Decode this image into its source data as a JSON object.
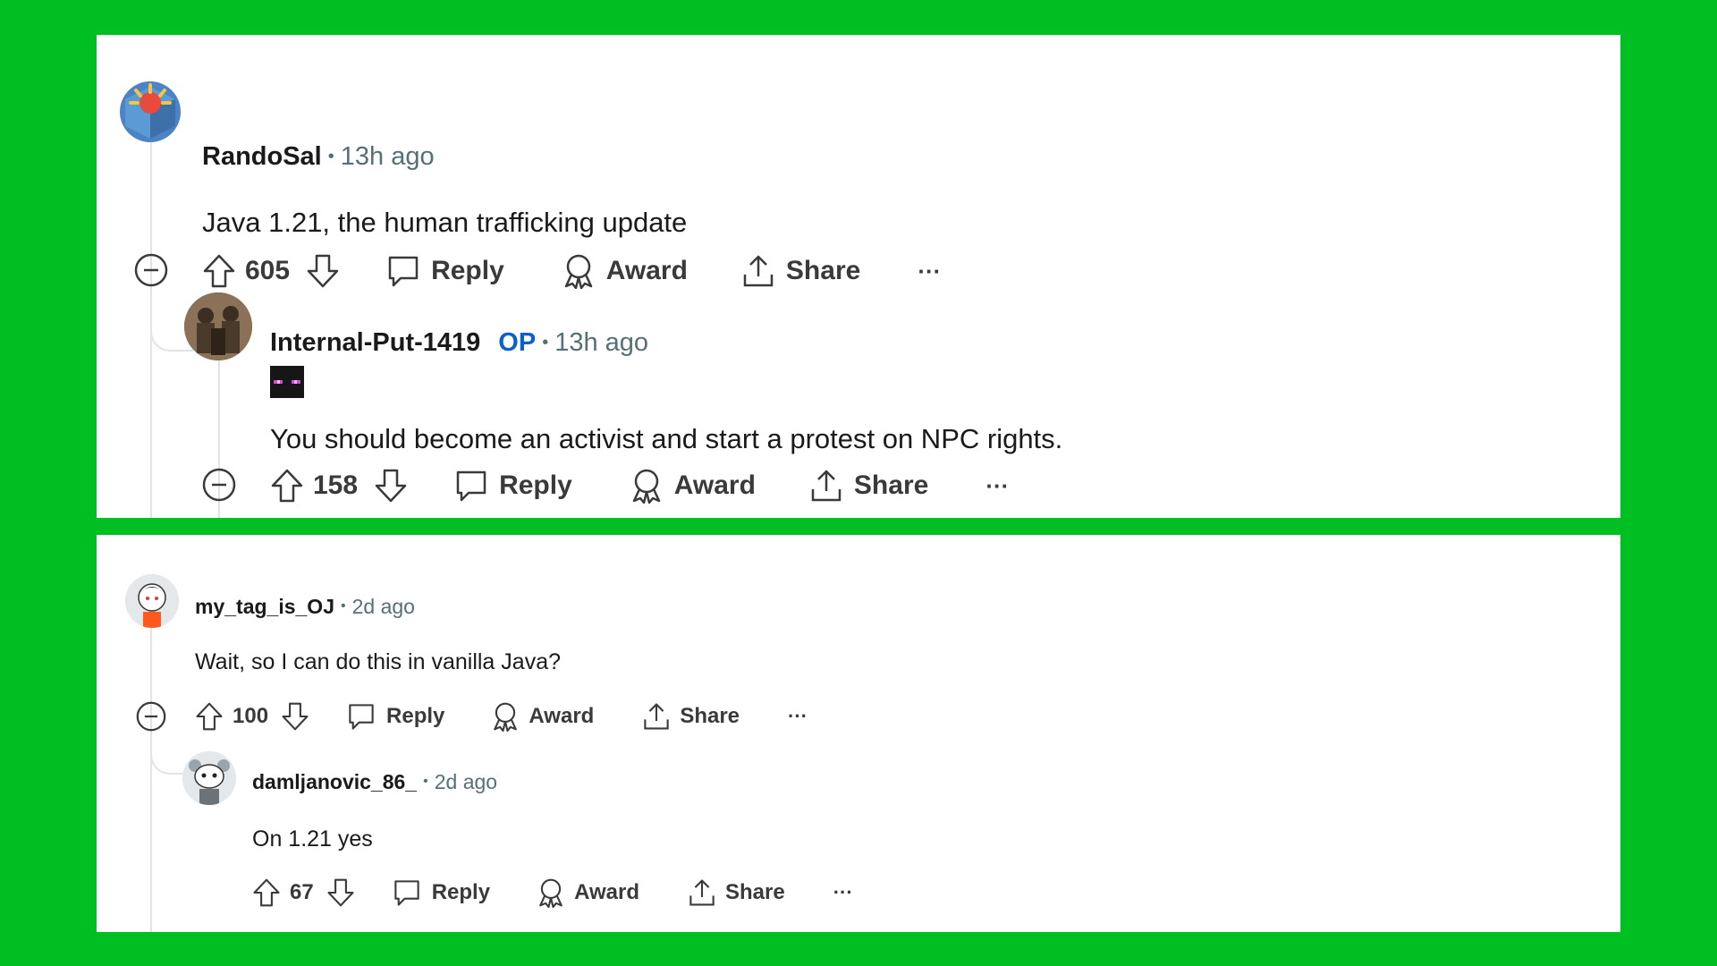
{
  "colors": {
    "background": "#00bf22",
    "panel": "#ffffff",
    "op_badge": "#0a5fd1",
    "meta": "#576f76",
    "thread_line": "#e1e4e6"
  },
  "labels": {
    "reply": "Reply",
    "award": "Award",
    "share": "Share",
    "more": "···"
  },
  "top_thread": {
    "comment": {
      "username": "RandoSal",
      "separator": "•",
      "time": "13h ago",
      "text": "Java 1.21, the human trafficking update",
      "votes": "605"
    },
    "reply": {
      "username": "Internal-Put-1419",
      "op_badge": "OP",
      "separator": "•",
      "time": "13h ago",
      "flair_icon": "enderman-face-icon",
      "text": "You should become an activist and start a protest on NPC rights.",
      "votes": "158"
    }
  },
  "bottom_thread": {
    "comment": {
      "username": "my_tag_is_OJ",
      "separator": "•",
      "time": "2d ago",
      "text": "Wait, so I can do this in vanilla Java?",
      "votes": "100"
    },
    "reply": {
      "username": "damljanovic_86_",
      "separator": "•",
      "time": "2d ago",
      "text": "On 1.21 yes",
      "votes": "67"
    }
  }
}
